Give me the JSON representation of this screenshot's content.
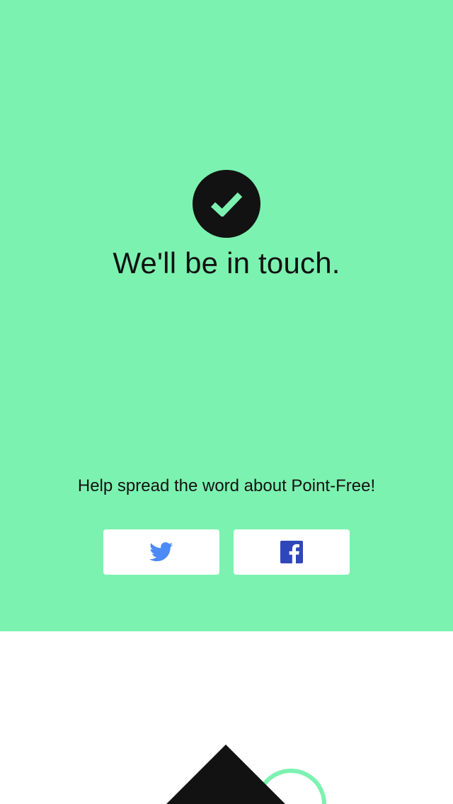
{
  "confirmation": {
    "icon": "checkmark-icon",
    "headline": "We'll be in touch."
  },
  "share": {
    "prompt": "Help spread the word about Point-Free!",
    "buttons": [
      {
        "network": "twitter",
        "icon": "twitter-icon",
        "color": "#4c8bf5"
      },
      {
        "network": "facebook",
        "icon": "facebook-icon",
        "color": "#2f47b8"
      }
    ]
  },
  "colors": {
    "accent": "#7cf2b0",
    "dark": "#121212",
    "white": "#ffffff"
  }
}
